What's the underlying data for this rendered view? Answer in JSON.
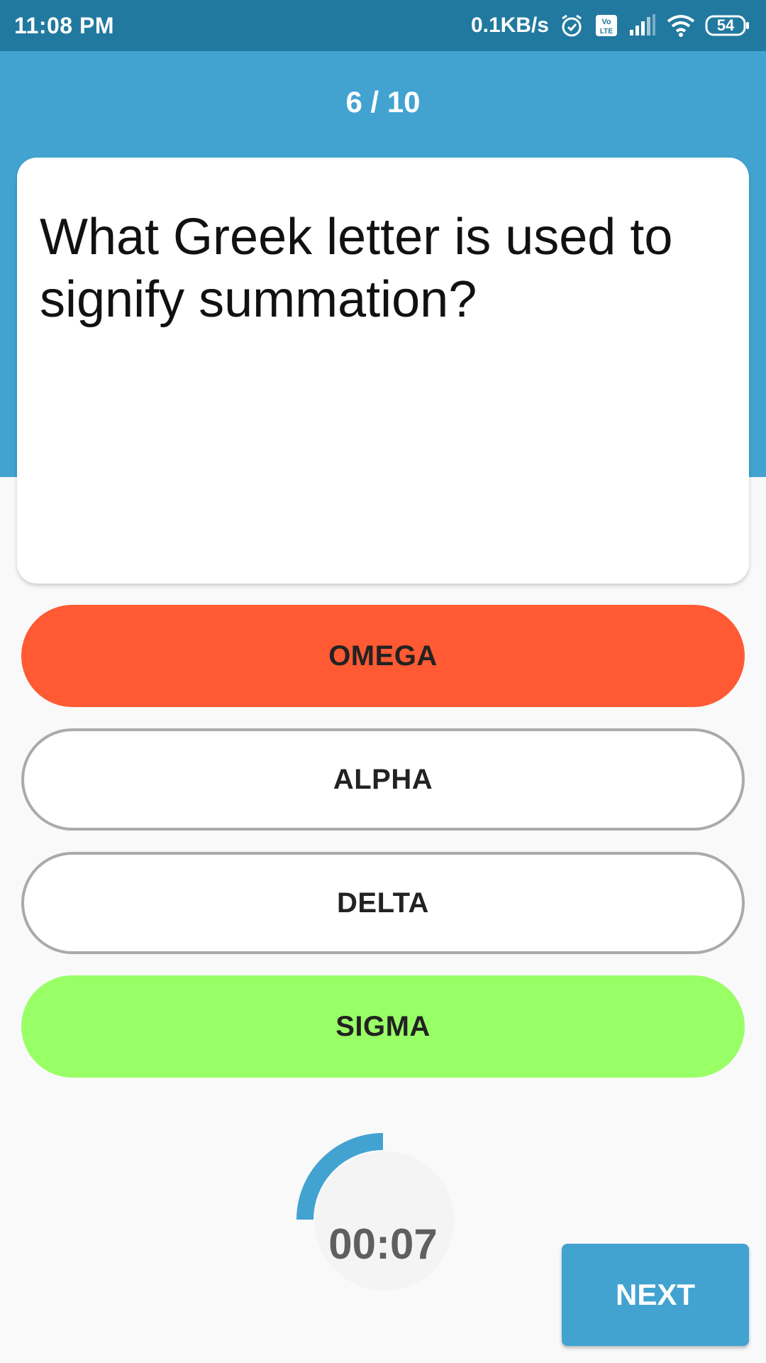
{
  "status_bar": {
    "time": "11:08 PM",
    "net_speed": "0.1KB/s",
    "battery": "54",
    "icons": [
      "alarm-icon",
      "volte-icon",
      "cell-signal-icon",
      "wifi-icon",
      "battery-icon"
    ]
  },
  "quiz": {
    "progress": "6 / 10",
    "question": "What Greek letter is used to signify summation?",
    "answers": [
      {
        "label": "OMEGA",
        "state": "wrong"
      },
      {
        "label": "ALPHA",
        "state": "neutral"
      },
      {
        "label": "DELTA",
        "state": "neutral"
      },
      {
        "label": "SIGMA",
        "state": "correct"
      }
    ],
    "timer": {
      "text": "00:07",
      "remaining_fraction": 0.25
    },
    "next_label": "NEXT"
  },
  "colors": {
    "status_bar": "#22799f",
    "header": "#42a3d1",
    "wrong": "#ff5a33",
    "correct": "#99ff66",
    "timer_arc": "#42a3d1"
  }
}
